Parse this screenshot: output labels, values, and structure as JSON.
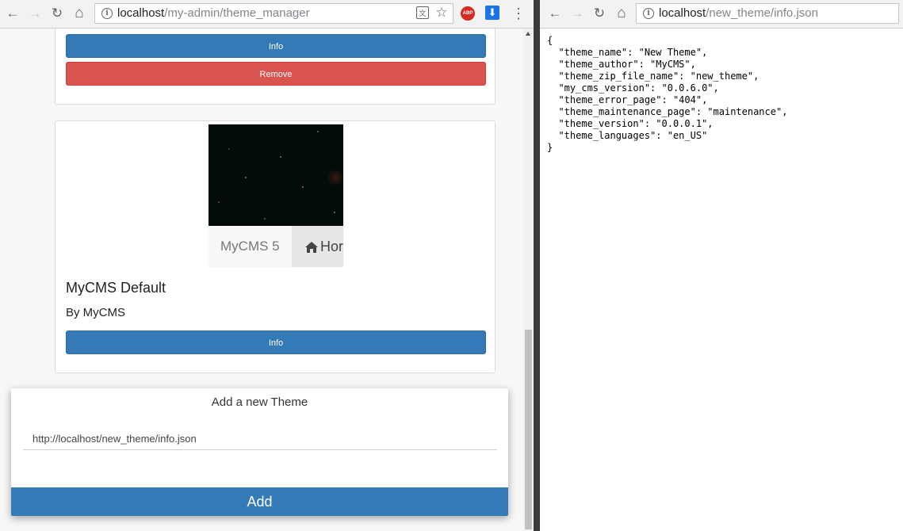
{
  "left_window": {
    "url_host": "localhost",
    "url_path": "/my-admin/theme_manager",
    "nav": {
      "back": "←",
      "forward": "→",
      "reload": "↻",
      "home": "⌂",
      "menu": "⋮"
    },
    "omnibox_icons": {
      "translate": "文",
      "bookmark": "☆"
    },
    "extensions": {
      "abp": "ABP",
      "download": "⬇"
    },
    "cards": [
      {
        "buttons": {
          "info": "Info",
          "remove": "Remove"
        }
      },
      {
        "preview": {
          "brand": "MyCMS 5",
          "home": "Hor"
        },
        "name": "MyCMS Default",
        "author": "By MyCMS",
        "buttons": {
          "info": "Info"
        }
      }
    ],
    "modal": {
      "title": "Add a new Theme",
      "input_value": "http://localhost/new_theme/info.json",
      "add_label": "Add"
    }
  },
  "right_window": {
    "url_host": "localhost",
    "url_path": "/new_theme/info.json",
    "nav": {
      "back": "←",
      "forward": "→",
      "reload": "↻",
      "home": "⌂"
    },
    "json_lines": [
      "{",
      "  \"theme_name\": \"New Theme\",",
      "  \"theme_author\": \"MyCMS\",",
      "  \"theme_zip_file_name\": \"new_theme\",",
      "  \"my_cms_version\": \"0.0.6.0\",",
      "  \"theme_error_page\": \"404\",",
      "  \"theme_maintenance_page\": \"maintenance\",",
      "  \"theme_version\": \"0.0.0.1\",",
      "  \"theme_languages\": \"en_US\"",
      "}"
    ]
  },
  "colors": {
    "primary": "#337ab7",
    "danger": "#d9534f"
  }
}
